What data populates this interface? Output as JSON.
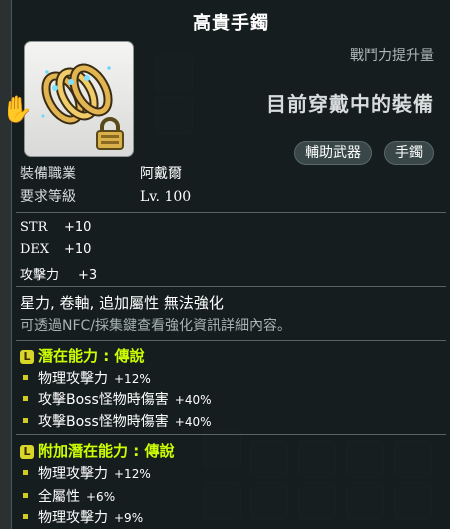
{
  "item": {
    "title": "高貴手鐲",
    "boost_label": "戰鬥力提升量",
    "equipped_text": "目前穿戴中的裝備",
    "tags": [
      "輔助武器",
      "手鐲"
    ],
    "info": [
      {
        "label": "裝備職業",
        "value": "阿戴爾"
      },
      {
        "label": "要求等級",
        "value": "Lv. 100"
      }
    ],
    "stats": [
      {
        "name": "STR",
        "value": "+10"
      },
      {
        "name": "DEX",
        "value": "+10"
      },
      {
        "name": "攻擊力",
        "value": "+3"
      }
    ],
    "traits": "星力, 卷軸, 追加屬性 無法強化",
    "nfc_note": "可透過NFC/採集鍵查看強化資訊詳細內容。",
    "potential": {
      "badge": "L",
      "header": "潛在能力 : 傳說",
      "lines": [
        {
          "label": "物理攻擊力",
          "amount": "+12%"
        },
        {
          "label": "攻擊Boss怪物時傷害",
          "amount": "+40%"
        },
        {
          "label": "攻擊Boss怪物時傷害",
          "amount": "+40%"
        }
      ]
    },
    "additional_potential": {
      "badge": "L",
      "header": "附加潛在能力 : 傳說",
      "lines": [
        {
          "label": "物理攻擊力",
          "amount": "+12%"
        },
        {
          "label": "全屬性",
          "amount": "+6%"
        },
        {
          "label": "物理攻擊力",
          "amount": "+9%"
        }
      ]
    }
  },
  "colors": {
    "potential_header": "#ccff00",
    "badge": "#d9d62a",
    "note": "#a7b3b3"
  },
  "icons": [
    "bracelet-item-icon",
    "lock-icon",
    "white-glove-icon"
  ]
}
